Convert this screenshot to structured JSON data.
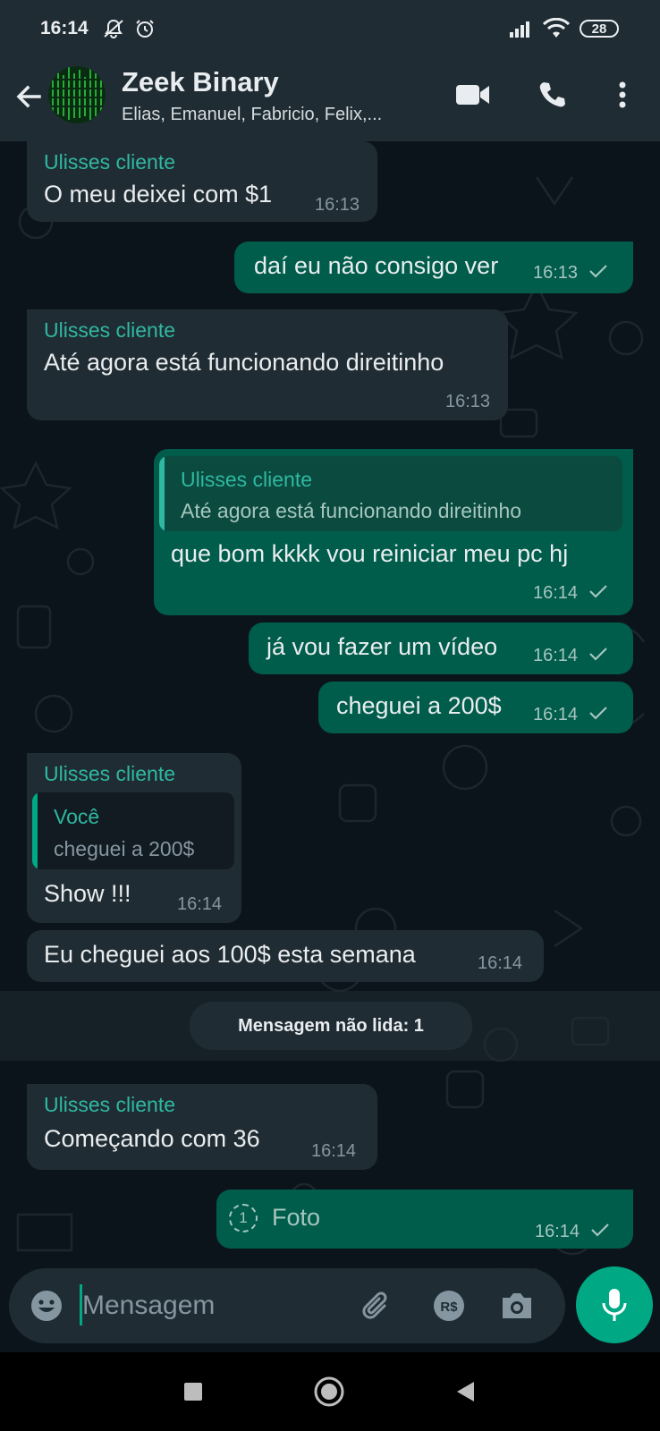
{
  "status_bar": {
    "time": "16:14",
    "battery": "28"
  },
  "header": {
    "title": "Zeek Binary",
    "subtitle": "Elias, Emanuel, Fabricio, Felix,..."
  },
  "messages": [
    {
      "sender": "Ulisses cliente",
      "text": "O meu deixei com $1",
      "time": "16:13"
    },
    {
      "text": "daí eu não consigo ver",
      "time": "16:13"
    },
    {
      "sender": "Ulisses cliente",
      "text": "Até agora está funcionando direitinho",
      "time": "16:13"
    },
    {
      "quote_name": "Ulisses cliente",
      "quote_text": "Até agora está funcionando direitinho",
      "text": "que bom kkkk vou reiniciar meu pc hj",
      "time": "16:14"
    },
    {
      "text": "já vou fazer um vídeo",
      "time": "16:14"
    },
    {
      "text": "cheguei a 200$",
      "time": "16:14"
    },
    {
      "sender": "Ulisses cliente",
      "quote_name": "Você",
      "quote_text": "cheguei a 200$",
      "text": "Show !!!",
      "time": "16:14"
    },
    {
      "text": "Eu cheguei aos 100$ esta semana",
      "time": "16:14"
    },
    {
      "sender": "Ulisses cliente",
      "text": "Começando com 36",
      "time": "16:14"
    },
    {
      "text": "Foto",
      "time": "16:14",
      "view_once": "1"
    }
  ],
  "unread_banner": "Mensagem não lida: 1",
  "input": {
    "placeholder": "Mensagem"
  },
  "colors": {
    "header_bg": "#1f2c34",
    "chat_bg": "#0b141a",
    "incoming_bubble": "#202c33",
    "outgoing_bubble": "#005c4b",
    "sender_name": "#2fb8a2",
    "accent": "#00a884"
  },
  "icons": [
    "back-arrow-icon",
    "video-call-icon",
    "voice-call-icon",
    "more-options-icon",
    "emoji-icon",
    "attach-icon",
    "payment-icon",
    "camera-icon",
    "mic-icon",
    "check-icon",
    "view-once-icon",
    "nav-recent-icon",
    "nav-home-icon",
    "nav-back-icon"
  ]
}
